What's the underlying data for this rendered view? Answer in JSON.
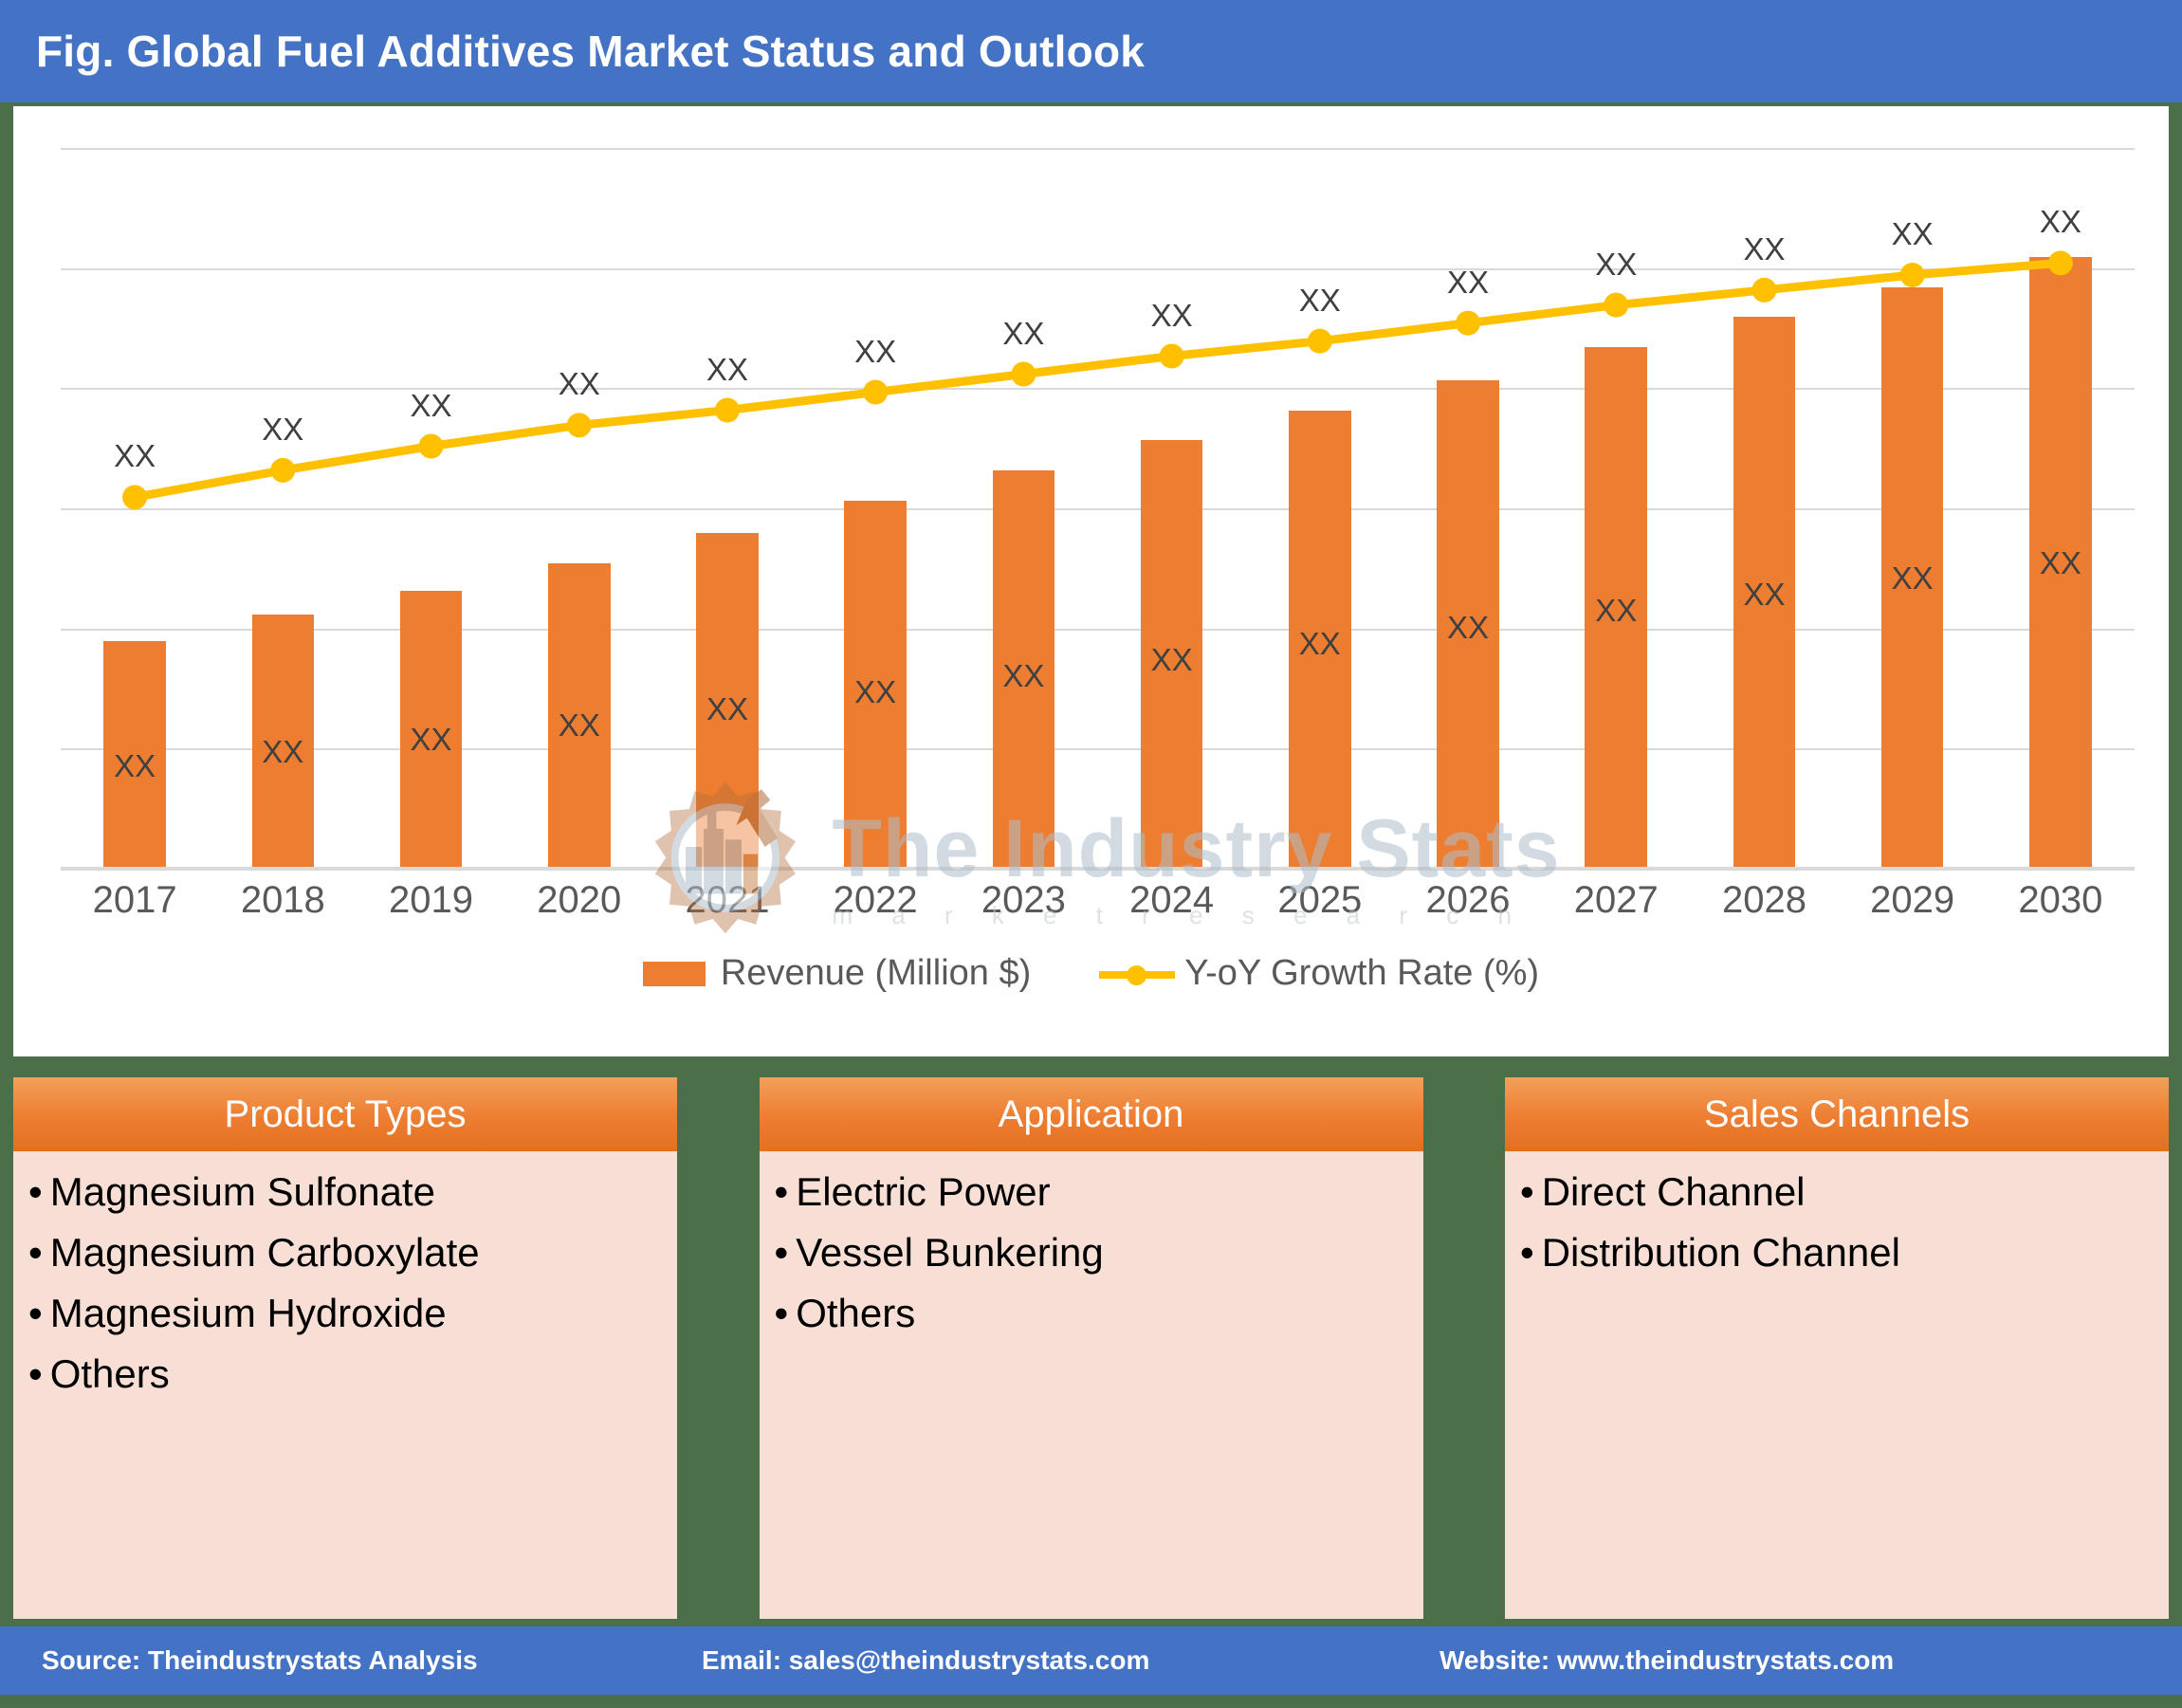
{
  "header": {
    "title": "Fig. Global Fuel Additives Market Status and Outlook",
    "background_color": "#4472C4"
  },
  "watermark": {
    "title": "The Industry Stats",
    "subtitle": "m a r k e t   r e s e a r c h",
    "logo_name": "gear-factory-logo"
  },
  "chart_data": {
    "type": "bar",
    "title": "Fig. Global Fuel Additives Market Status and Outlook",
    "xlabel": "",
    "ylabel": "",
    "grid": true,
    "legend_position": "bottom",
    "categories": [
      "2017",
      "2018",
      "2019",
      "2020",
      "2021",
      "2022",
      "2023",
      "2024",
      "2025",
      "2026",
      "2027",
      "2028",
      "2029",
      "2030"
    ],
    "series": [
      {
        "name": "Revenue (Million $)",
        "chart_type": "bar",
        "color": "#ED7D31",
        "axis": "left",
        "values": [
          38.0,
          42.5,
          46.5,
          51.0,
          56.0,
          61.5,
          66.5,
          71.5,
          76.5,
          81.5,
          87.0,
          92.0,
          97.0,
          102.0
        ],
        "data_labels": [
          "XX",
          "XX",
          "XX",
          "XX",
          "XX",
          "XX",
          "XX",
          "XX",
          "XX",
          "XX",
          "XX",
          "XX",
          "XX",
          "XX"
        ],
        "data_label_position": "inside"
      },
      {
        "name": "Y-oY Growth Rate (%)",
        "chart_type": "line",
        "color": "#FFC000",
        "axis": "right",
        "marker": "circle",
        "values": [
          62.0,
          66.5,
          70.5,
          74.0,
          76.5,
          79.5,
          82.5,
          85.5,
          88.0,
          91.0,
          94.0,
          96.5,
          99.0,
          101.0
        ],
        "data_labels": [
          "XX",
          "XX",
          "XX",
          "XX",
          "XX",
          "XX",
          "XX",
          "XX",
          "XX",
          "XX",
          "XX",
          "XX",
          "XX",
          "XX"
        ],
        "data_label_position": "above"
      }
    ],
    "ylim": [
      0,
      120
    ],
    "gridline_values": [
      0,
      20,
      40,
      60,
      80,
      100,
      120
    ]
  },
  "legend": {
    "items": [
      {
        "label": "Revenue (Million $)",
        "color": "#ED7D31",
        "marker": "bar"
      },
      {
        "label": "Y-oY Growth Rate (%)",
        "color": "#FFC000",
        "marker": "line-dot"
      }
    ]
  },
  "segments": [
    {
      "title": "Product Types",
      "items": [
        "Magnesium Sulfonate",
        "Magnesium Carboxylate",
        "Magnesium Hydroxide",
        "Others"
      ]
    },
    {
      "title": "Application",
      "items": [
        "Electric Power",
        "Vessel Bunkering",
        "Others"
      ]
    },
    {
      "title": "Sales Channels",
      "items": [
        "Direct Channel",
        "Distribution Channel"
      ]
    }
  ],
  "footer": {
    "source": "Source: Theindustrystats Analysis",
    "email": "Email: sales@theindustrystats.com",
    "website": "Website: www.theindustrystats.com",
    "background_color": "#4472C4"
  },
  "colors": {
    "page_border": "#4B7049",
    "bar": "#ED7D31",
    "line": "#FFC000",
    "header": "#4472C4",
    "segment_body": "#F8DFD6",
    "gridline": "#D9D9D9"
  }
}
